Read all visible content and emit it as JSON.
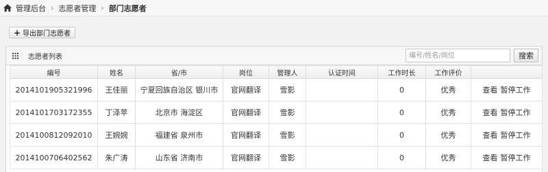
{
  "breadcrumb": {
    "home": "管理后台",
    "section": "志愿者管理",
    "current": "部门志愿者"
  },
  "toolbar": {
    "export_label": "导出部门志愿者"
  },
  "panel": {
    "title": "志愿者列表",
    "search_placeholder": "编号/姓名/岗位",
    "search_button": "搜索"
  },
  "table": {
    "headers": [
      "编号",
      "姓名",
      "省/市",
      "岗位",
      "管理人",
      "认证时间",
      "工作时长",
      "工作评价",
      ""
    ],
    "rows": [
      [
        "2014101905321996",
        "王佳丽",
        "宁夏回族自治区 银川市",
        "官网翻译",
        "雪影",
        "",
        "0",
        "优秀"
      ],
      [
        "2014101703172355",
        "丁泽苹",
        "北京市 海淀区",
        "官网翻译",
        "雪影",
        "",
        "0",
        "优秀"
      ],
      [
        "2014100812092010",
        "王婉婉",
        "福建省 泉州市",
        "官网翻译",
        "雪影",
        "",
        "0",
        "优秀"
      ],
      [
        "2014100706402562",
        "朱广涛",
        "山东省 济南市",
        "官网翻译",
        "雪影",
        "",
        "0",
        "优秀"
      ]
    ],
    "actions": {
      "view": "查看",
      "pause": "暂停工作"
    }
  }
}
